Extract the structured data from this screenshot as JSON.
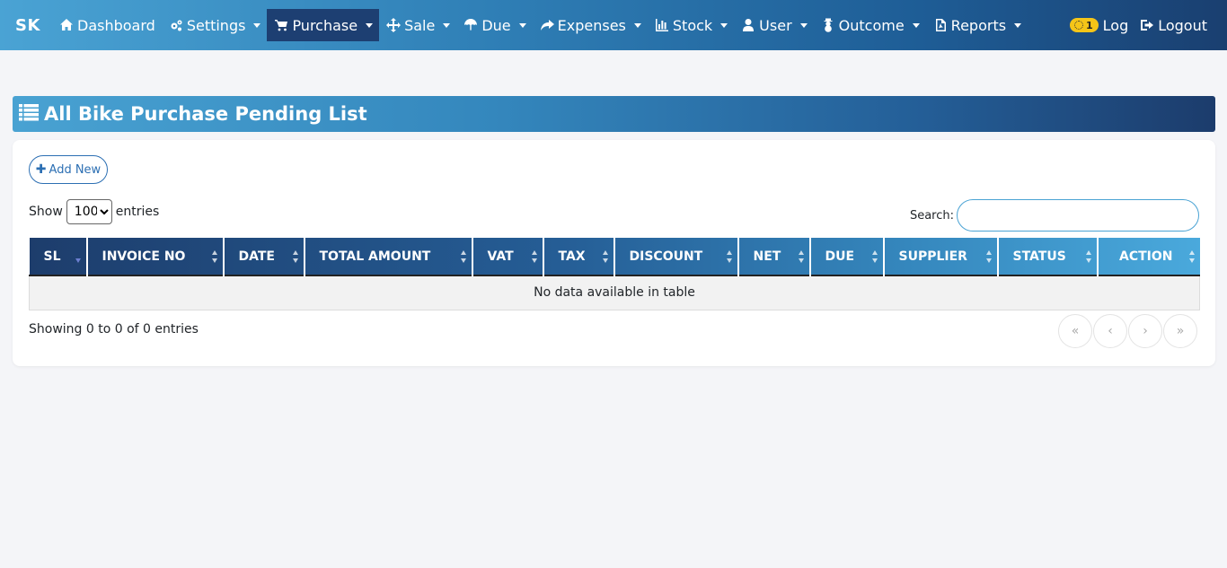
{
  "brand": "SK",
  "nav": {
    "items": [
      {
        "label": "Dashboard",
        "icon": "home-icon",
        "caret": false,
        "active": false
      },
      {
        "label": "Settings",
        "icon": "gears-icon",
        "caret": true,
        "active": false
      },
      {
        "label": "Purchase",
        "icon": "cart-icon",
        "caret": true,
        "active": true
      },
      {
        "label": "Sale",
        "icon": "arrows-icon",
        "caret": true,
        "active": false
      },
      {
        "label": "Due",
        "icon": "umbrella-icon",
        "caret": true,
        "active": false
      },
      {
        "label": "Expenses",
        "icon": "share-icon",
        "caret": true,
        "active": false
      },
      {
        "label": "Stock",
        "icon": "bar-chart-icon",
        "caret": true,
        "active": false
      },
      {
        "label": "User",
        "icon": "user-icon",
        "caret": true,
        "active": false
      },
      {
        "label": "Outcome",
        "icon": "snowman-icon",
        "caret": true,
        "active": false
      },
      {
        "label": "Reports",
        "icon": "pdf-file-icon",
        "caret": true,
        "active": false
      }
    ],
    "right": {
      "badge_count": "1",
      "log_label": "Log",
      "logout_label": "Logout"
    }
  },
  "page": {
    "title": "All Bike Purchase Pending List"
  },
  "card": {
    "add_new_label": "Add New",
    "show_label": "Show",
    "entries_label": "entries",
    "page_size": "100",
    "search_label": "Search:",
    "search_value": ""
  },
  "table": {
    "columns": [
      "SL",
      "INVOICE NO",
      "DATE",
      "TOTAL AMOUNT",
      "VAT",
      "TAX",
      "DISCOUNT",
      "NET",
      "DUE",
      "SUPPLIER",
      "STATUS",
      "ACTION"
    ],
    "empty_message": "No data available in table"
  },
  "footer": {
    "info": "Showing 0 to 0 of 0 entries",
    "pager": [
      "«",
      "‹",
      "›",
      "»"
    ]
  },
  "colors": {
    "accent": "#2c6fb3",
    "badge": "#f5c518",
    "active_nav": "#1d3f72"
  }
}
